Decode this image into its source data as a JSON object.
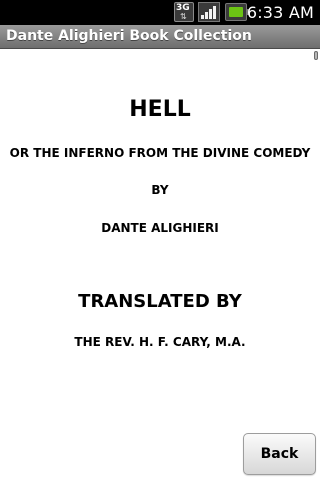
{
  "status_bar": {
    "time": "6:33 AM",
    "network_label": "3G",
    "network_icon": "3g-data-icon",
    "signal_icon": "signal-strength-icon",
    "battery_icon": "battery-icon",
    "battery_color": "#6cc314"
  },
  "app": {
    "title": "Dante Alighieri Book Collection"
  },
  "book": {
    "title": "HELL",
    "subtitle": "OR THE INFERNO FROM THE DIVINE COMEDY",
    "by": "BY",
    "author": "DANTE ALIGHIERI",
    "translated_by": "TRANSLATED BY",
    "translator": "THE REV. H. F. CARY, M.A."
  },
  "actions": {
    "back_label": "Back"
  }
}
